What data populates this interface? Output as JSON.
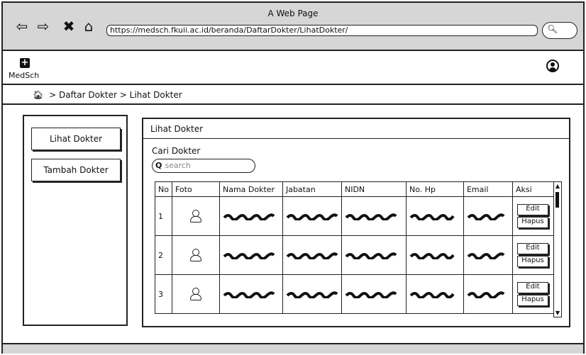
{
  "window": {
    "title": "A Web Page",
    "url": "https://medsch.fkuii.ac.id/beranda/DaftarDokter/LihatDokter/"
  },
  "browser_icons": [
    "back-arrow-icon",
    "forward-arrow-icon",
    "close-icon",
    "home-icon"
  ],
  "brand": {
    "name": "MedSch",
    "logo_glyph": "+"
  },
  "breadcrumb": {
    "items": [
      "Daftar Dokter",
      "Lihat Dokter"
    ],
    "separator": ">"
  },
  "sidebar": {
    "items": [
      "Lihat Dokter",
      "Tambah Dokter"
    ]
  },
  "panel": {
    "title": "Lihat Dokter",
    "search_label": "Cari Dokter",
    "search_placeholder": "search",
    "columns": [
      "No",
      "Foto",
      "Nama Dokter",
      "Jabatan",
      "NIDN",
      "No. Hp",
      "Email",
      "Aksi"
    ],
    "rows": [
      {
        "no": "1"
      },
      {
        "no": "2"
      },
      {
        "no": "3"
      }
    ],
    "actions": {
      "edit": "Edit",
      "delete": "Hapus"
    }
  }
}
